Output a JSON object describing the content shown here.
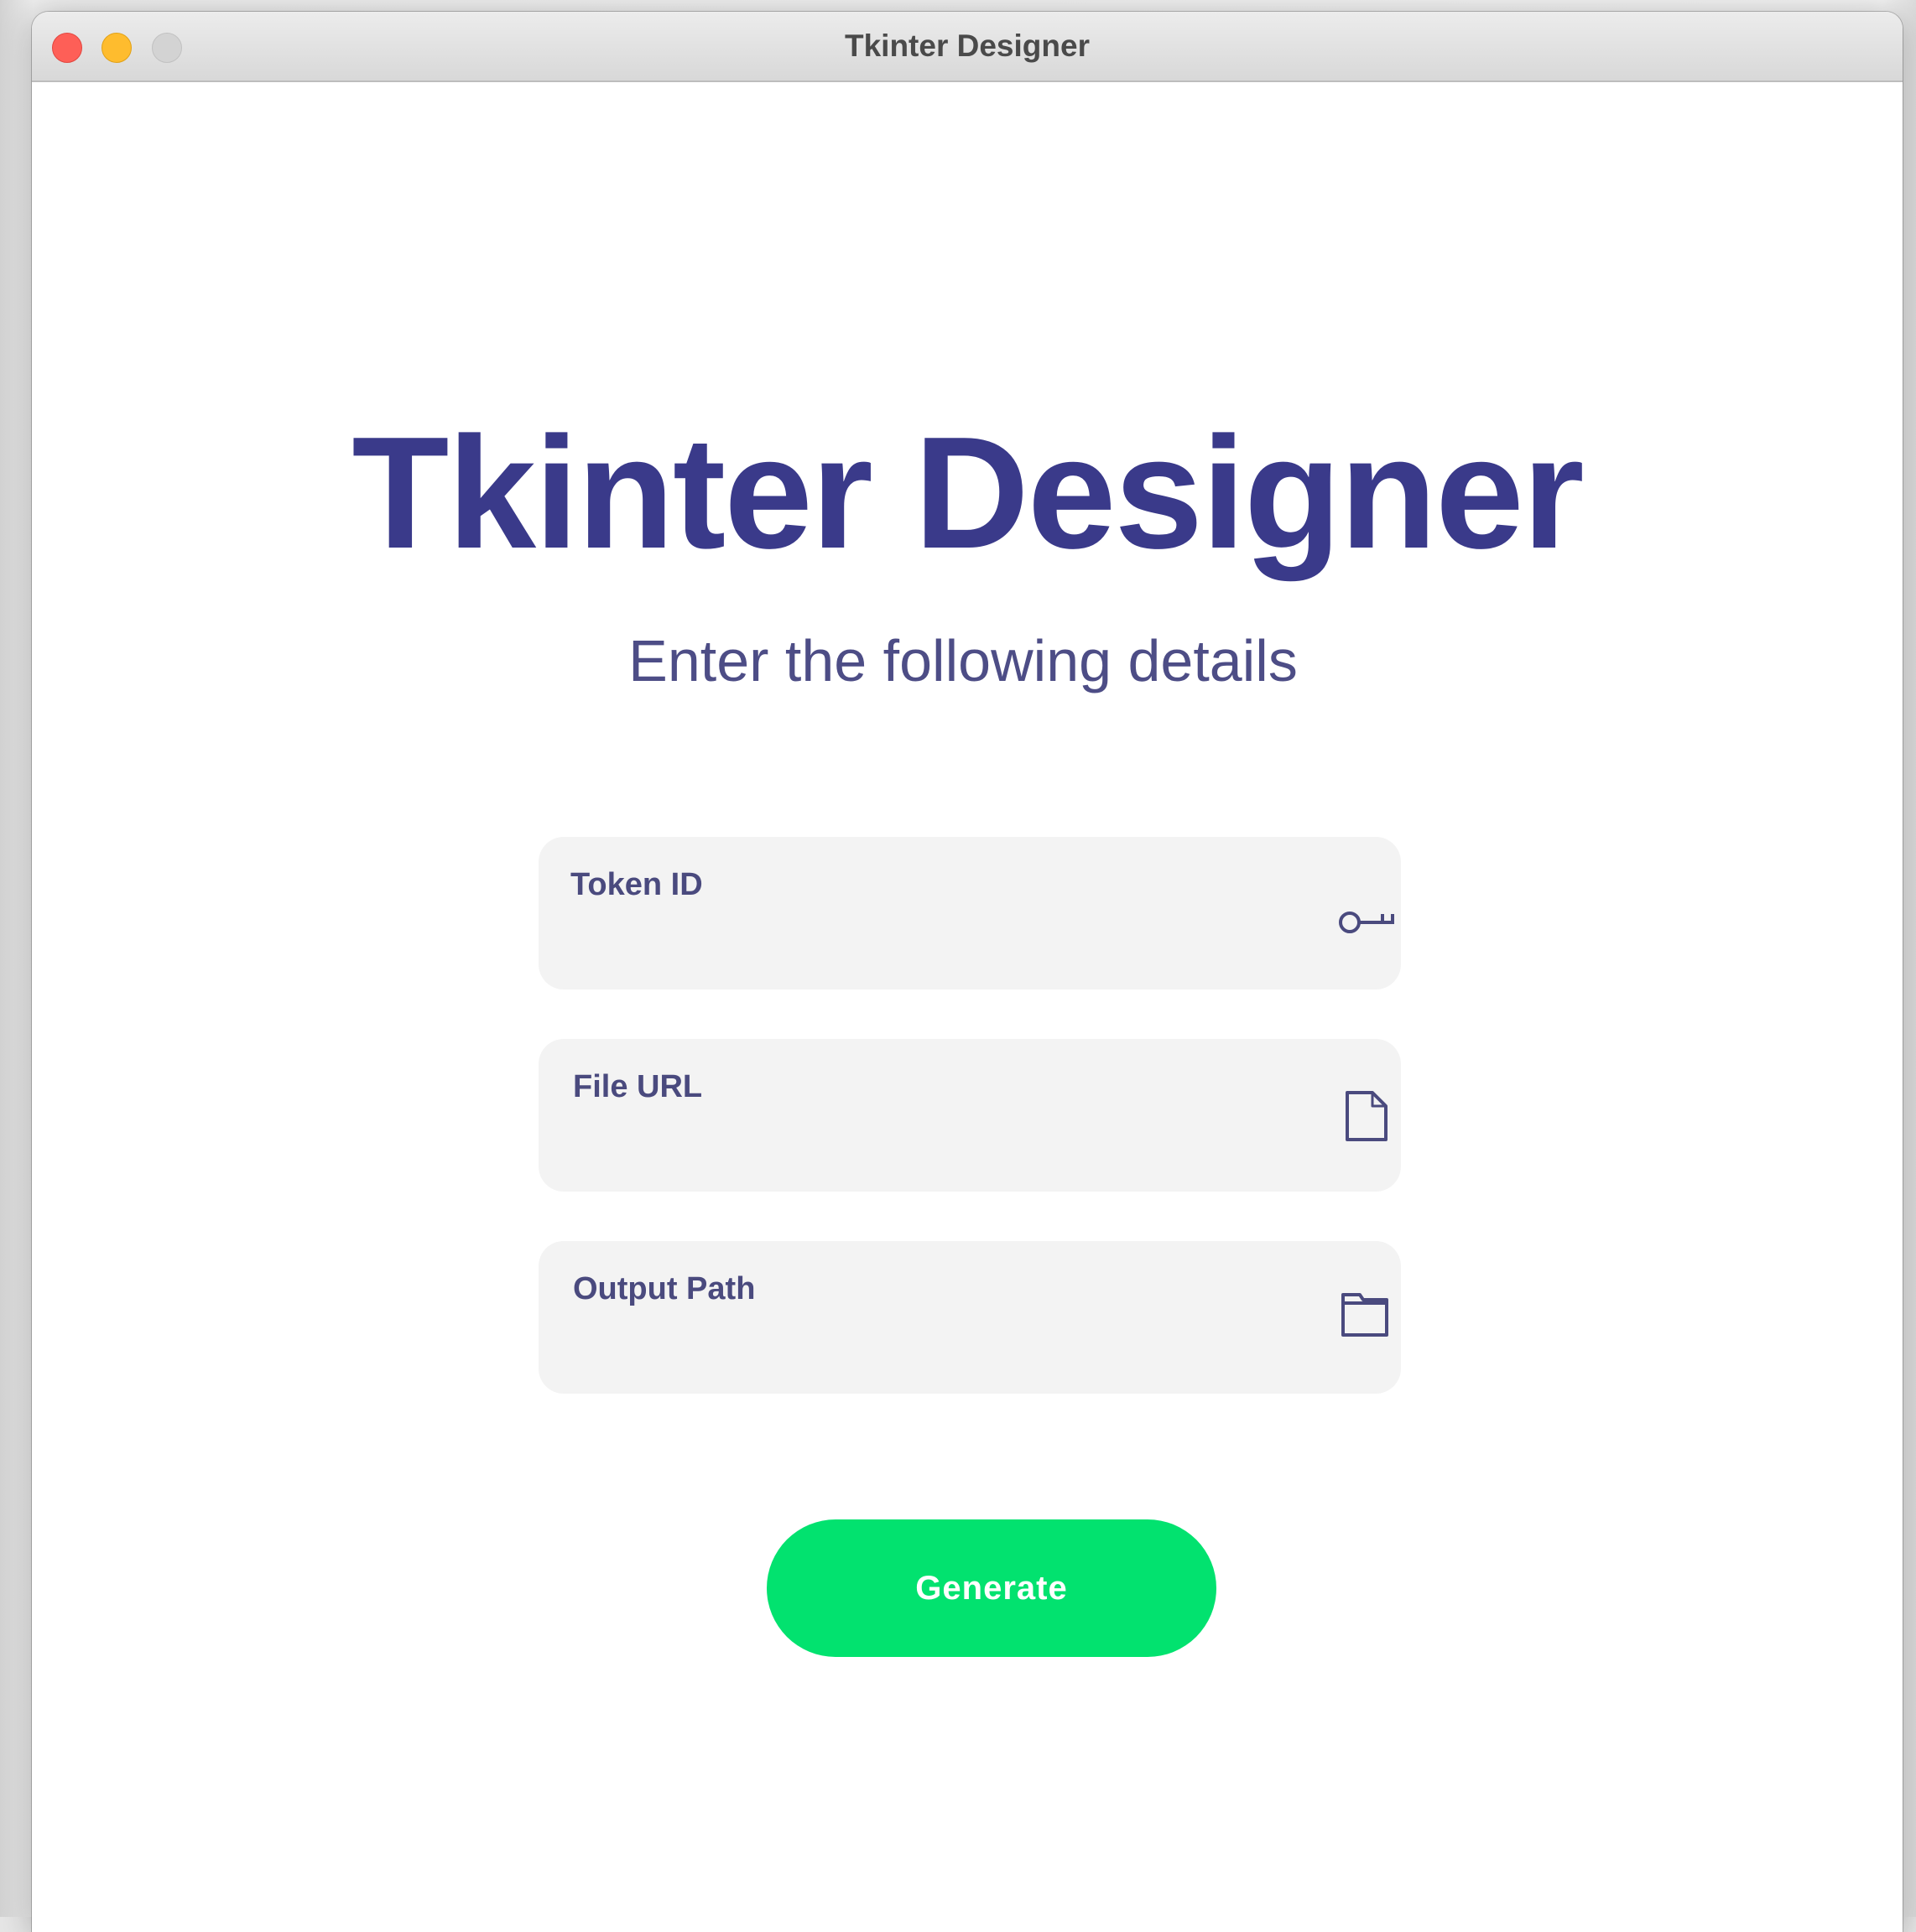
{
  "window": {
    "title": "Tkinter Designer"
  },
  "main": {
    "heading": "Tkinter Designer",
    "subheading": "Enter the following details"
  },
  "fields": [
    {
      "label": "Token ID",
      "value": "",
      "icon": "key-icon"
    },
    {
      "label": "File URL",
      "value": "",
      "icon": "file-icon"
    },
    {
      "label": "Output Path",
      "value": "",
      "icon": "folder-icon"
    }
  ],
  "actions": {
    "generate_label": "Generate"
  },
  "colors": {
    "heading": "#3a3a8a",
    "label": "#4a4a7e",
    "field_bg": "#f3f3f3",
    "button_bg": "#02e26f",
    "button_text": "#ffffff"
  }
}
